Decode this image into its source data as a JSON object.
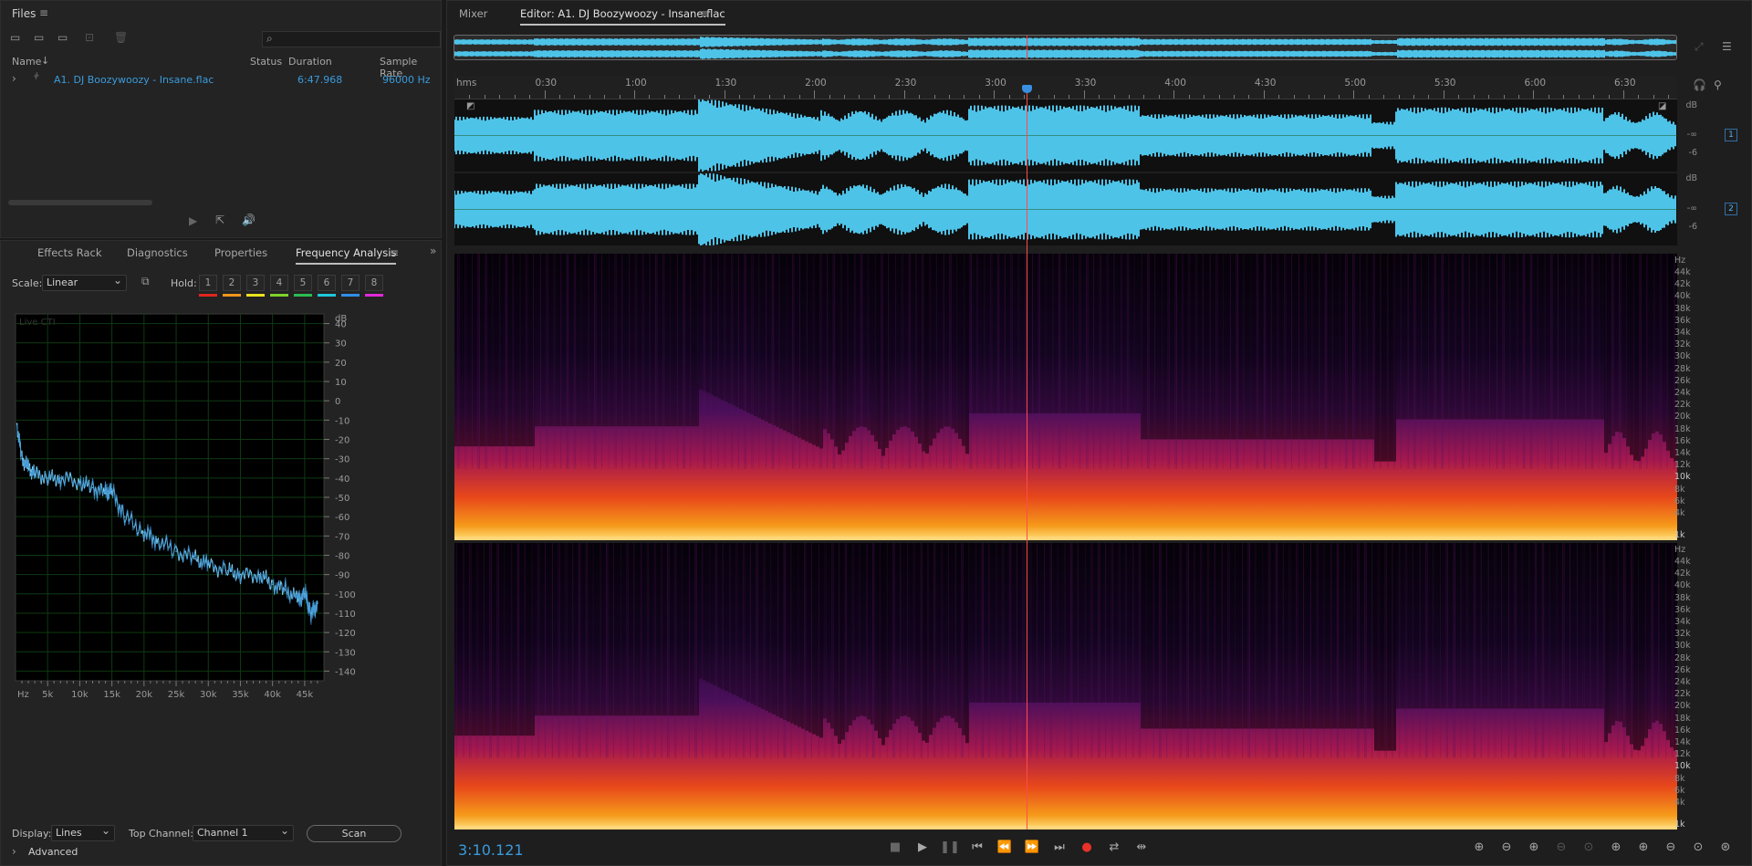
{
  "files_panel": {
    "title": "Files",
    "search_placeholder": "",
    "columns": [
      "Name",
      "Status",
      "Duration",
      "Sample Rate"
    ],
    "rows": [
      {
        "name": "A1. DJ Boozywoozy - Insane.flac",
        "status": "",
        "duration": "6:47.968",
        "sample_rate": "96000 Hz"
      }
    ]
  },
  "analysis_panel": {
    "tabs": [
      "Effects Rack",
      "Diagnostics",
      "Properties",
      "Frequency Analysis"
    ],
    "active_tab": "Frequency Analysis",
    "scale_label": "Scale:",
    "scale_value": "Linear",
    "hold_label": "Hold:",
    "hold_buttons": [
      "1",
      "2",
      "3",
      "4",
      "5",
      "6",
      "7",
      "8"
    ],
    "hold_colors": [
      "#e0261e",
      "#f0951c",
      "#ece31f",
      "#7fd12a",
      "#2bbd4f",
      "#1fc7d8",
      "#2f8fe8",
      "#e22ad9"
    ],
    "live_label": "Live CTI",
    "db_ticks": [
      "dB",
      "40",
      "30",
      "20",
      "10",
      "0",
      "-10",
      "-20",
      "-30",
      "-40",
      "-50",
      "-60",
      "-70",
      "-80",
      "-90",
      "-100",
      "-110",
      "-120",
      "-130",
      "-140"
    ],
    "hz_ticks": [
      "Hz",
      "5k",
      "10k",
      "15k",
      "20k",
      "25k",
      "30k",
      "35k",
      "40k",
      "45k"
    ],
    "display_label": "Display:",
    "display_value": "Lines",
    "top_channel_label": "Top Channel:",
    "top_channel_value": "Channel 1",
    "scan_label": "Scan",
    "advanced_label": "Advanced"
  },
  "editor": {
    "mixer_tab": "Mixer",
    "editor_tab": "Editor: A1. DJ Boozywoozy - Insane.flac",
    "ruler": [
      "hms",
      "0:30",
      "1:00",
      "1:30",
      "2:00",
      "2:30",
      "3:00",
      "3:30",
      "4:00",
      "4:30",
      "5:00",
      "5:30",
      "6:00",
      "6:30"
    ],
    "wave_db_labels": [
      "dB",
      "-∞",
      "-6"
    ],
    "channel_badges": [
      "1",
      "2"
    ],
    "spectral_ticks": [
      "Hz",
      "44k",
      "42k",
      "40k",
      "38k",
      "36k",
      "34k",
      "32k",
      "30k",
      "28k",
      "26k",
      "24k",
      "22k",
      "20k",
      "18k",
      "16k",
      "14k",
      "12k",
      "10k",
      "8k",
      "6k",
      "4k",
      "1k"
    ],
    "time_display": "3:10.121",
    "playhead_fraction": 0.468
  },
  "colors": {
    "waveform": "#4ec3e8",
    "accent": "#3a9bdc",
    "record": "#e8312a",
    "playhead": "#ff3b3b"
  },
  "chart_data": {
    "type": "line",
    "title": "",
    "xlabel": "Hz",
    "ylabel": "dB",
    "xlim": [
      0,
      48000
    ],
    "ylim": [
      -145,
      45
    ],
    "series": [
      {
        "name": "",
        "x": [
          200,
          1000,
          2000,
          3000,
          5000,
          7000,
          10000,
          12000,
          14000,
          15000,
          17000,
          20000,
          22000,
          25000,
          28000,
          30000,
          33000,
          35000,
          38000,
          40000,
          42000,
          44000,
          45000,
          46000,
          47000
        ],
        "y": [
          -12,
          -30,
          -35,
          -38,
          -40,
          -40,
          -42,
          -45,
          -48,
          -47,
          -60,
          -68,
          -72,
          -78,
          -82,
          -85,
          -88,
          -90,
          -90,
          -95,
          -98,
          -103,
          -100,
          -110,
          -105
        ]
      }
    ]
  }
}
